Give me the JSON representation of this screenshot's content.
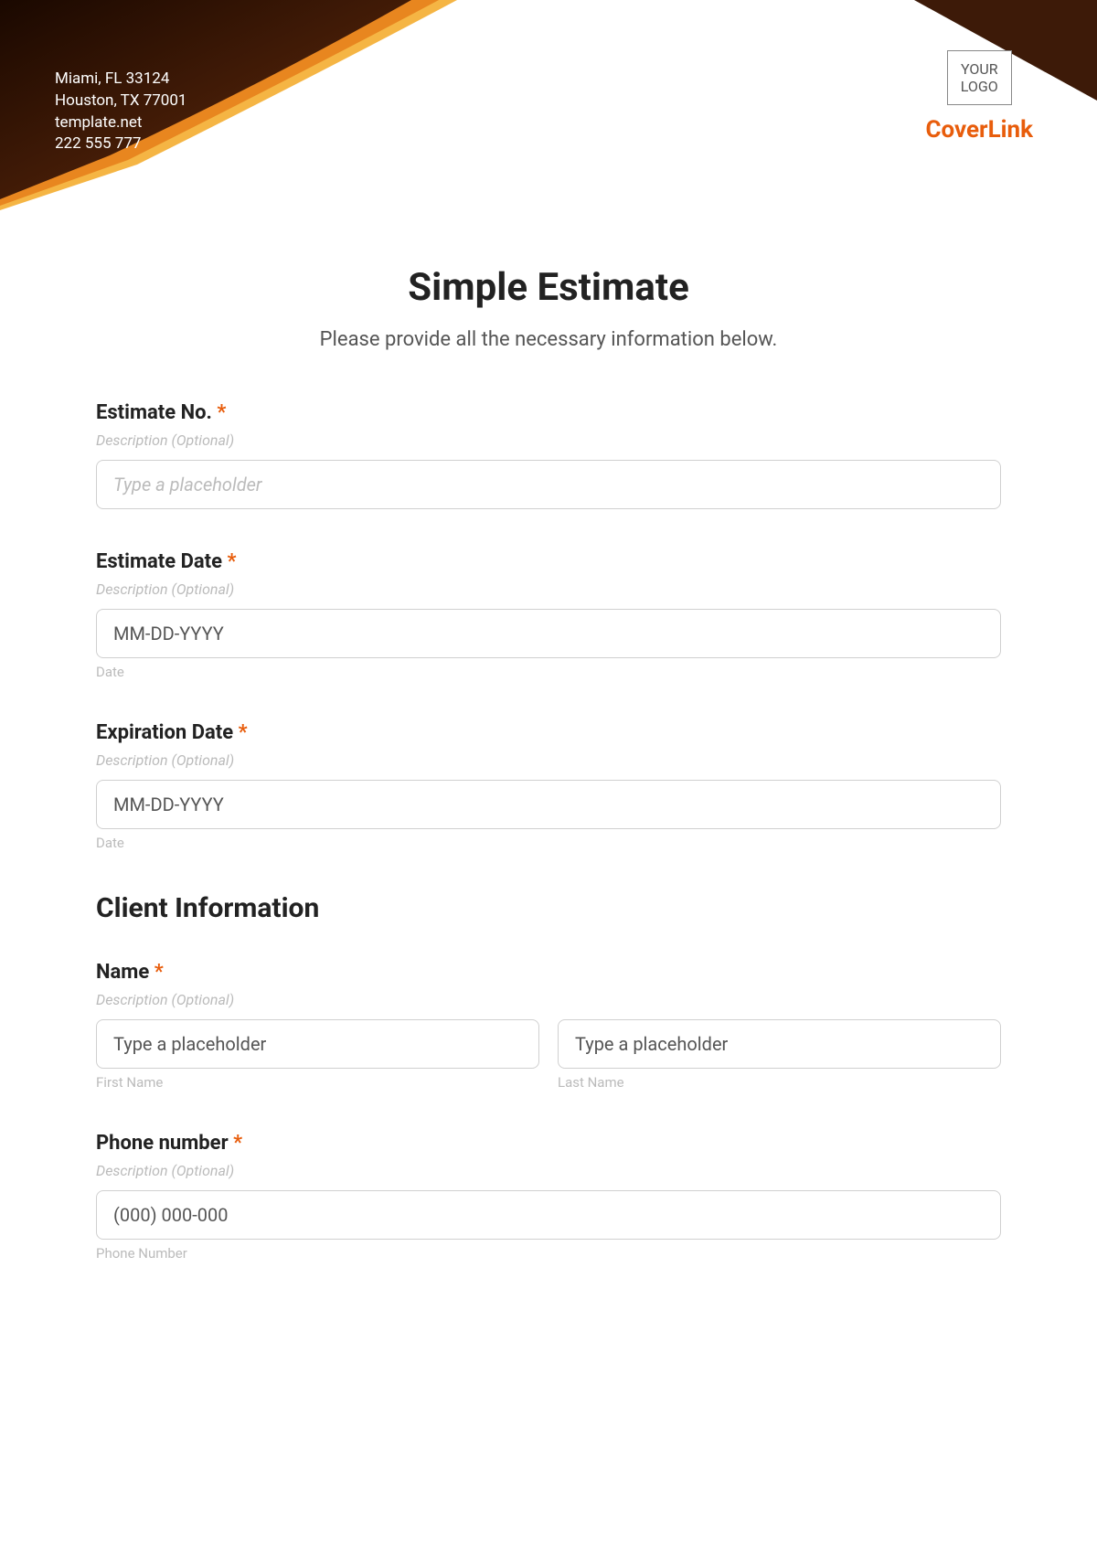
{
  "header": {
    "address1": "Miami, FL 33124",
    "address2": "Houston, TX 77001",
    "website": "template.net",
    "phone": "222 555 777",
    "logoText": "YOUR\nLOGO",
    "brand": "CoverLink"
  },
  "form": {
    "title": "Simple Estimate",
    "subtitle": "Please provide all the necessary information below.",
    "fields": {
      "estimateNo": {
        "label": "Estimate No.",
        "desc": "Description (Optional)",
        "placeholder": "Type a placeholder"
      },
      "estimateDate": {
        "label": "Estimate Date",
        "desc": "Description (Optional)",
        "placeholder": "MM-DD-YYYY",
        "sublabel": "Date"
      },
      "expirationDate": {
        "label": "Expiration Date",
        "desc": "Description (Optional)",
        "placeholder": "MM-DD-YYYY",
        "sublabel": "Date"
      },
      "clientSection": "Client Information",
      "name": {
        "label": "Name",
        "desc": "Description (Optional)",
        "placeholderFirst": "Type a placeholder",
        "placeholderLast": "Type a placeholder",
        "sublabelFirst": "First Name",
        "sublabelLast": "Last Name"
      },
      "phone": {
        "label": "Phone number",
        "desc": "Description (Optional)",
        "placeholder": "(000) 000-000",
        "sublabel": "Phone Number"
      }
    }
  }
}
